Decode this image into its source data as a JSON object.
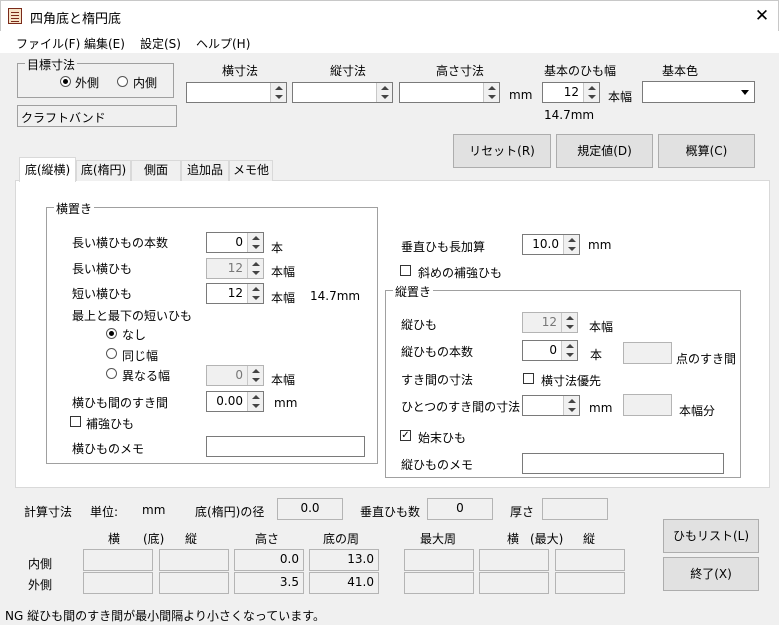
{
  "window": {
    "title": "四角底と楕円底",
    "close": "✕"
  },
  "menu": [
    {
      "label": "ファイル(F)"
    },
    {
      "label": "編集(E)"
    },
    {
      "label": "設定(S)"
    },
    {
      "label": "ヘルプ(H)"
    }
  ],
  "target": {
    "group_title": "目標寸法",
    "outer": "外側",
    "inner": "内側",
    "selected": "外側"
  },
  "top": {
    "width_label": "横寸法",
    "length_label": "縦寸法",
    "height_label": "高さ寸法",
    "mm": "mm",
    "band_label": "基本のひも幅",
    "band_value": "12",
    "band_unit": "本幅",
    "color_label": "基本色",
    "color_value": "",
    "band_mm": "14.7mm",
    "craft": "クラフトバンド"
  },
  "buttons": {
    "reset": "リセット(R)",
    "default": "規定値(D)",
    "overview": "概算(C)",
    "list": "ひもリスト(L)",
    "exit": "終了(X)"
  },
  "tabs": [
    "底(縦横)",
    "底(楕円)",
    "側面",
    "追加品",
    "メモ他"
  ],
  "yoko": {
    "title": "横置き",
    "long_count_label": "長い横ひもの本数",
    "long_count": "0",
    "unit_hon": "本",
    "long_label": "長い横ひも",
    "long_value": "12",
    "unit_honhaba": "本幅",
    "short_label": "短い横ひも",
    "short_value": "12",
    "short_mm": "14.7mm",
    "edge_label": "最上と最下の短いひも",
    "opt_none": "なし",
    "opt_same": "同じ幅",
    "opt_diff": "異なる幅",
    "diff_value": "0",
    "gap_label": "横ひも間のすき間",
    "gap_value": "0.00",
    "mm": "mm",
    "reinforce_label": "補強ひも",
    "memo_label": "横ひものメモ"
  },
  "right": {
    "vadd_label": "垂直ひも長加算",
    "vadd_value": "10.0",
    "mm": "mm",
    "diag_label": "斜めの補強ひも"
  },
  "tate": {
    "title": "縦置き",
    "tate_label": "縦ひも",
    "tate_value": "12",
    "unit_honhaba": "本幅",
    "count_label": "縦ひもの本数",
    "count_value": "0",
    "unit_hon": "本",
    "gap_suffix": "点のすき間",
    "gapsize_label": "すき間の寸法",
    "prio_label": "横寸法優先",
    "onegap_label": "ひとつのすき間の寸法",
    "mm": "mm",
    "honhaba_bun": "本幅分",
    "endcap_label": "始末ひも",
    "memo_label": "縦ひものメモ"
  },
  "calc": {
    "title": "計算寸法",
    "unit_label": "単位:",
    "unit": "mm",
    "diam_label": "底(楕円)の径",
    "diam_value": "0.0",
    "vcount_label": "垂直ひも数",
    "vcount_value": "0",
    "thick_label": "厚さ",
    "col_yoko": "横",
    "col_soko": "(底)",
    "col_tate": "縦",
    "col_height": "高さ",
    "col_circ": "底の周",
    "col_maxcirc": "最大周",
    "col_yoko2": "横",
    "col_max": "(最大)",
    "col_tate2": "縦",
    "row_inner": "内側",
    "row_outer": "外側",
    "inner_height": "0.0",
    "inner_circ": "13.0",
    "outer_height": "3.5",
    "outer_circ": "41.0"
  },
  "status": "NG  縦ひも間のすき間が最小間隔より小さくなっています。"
}
